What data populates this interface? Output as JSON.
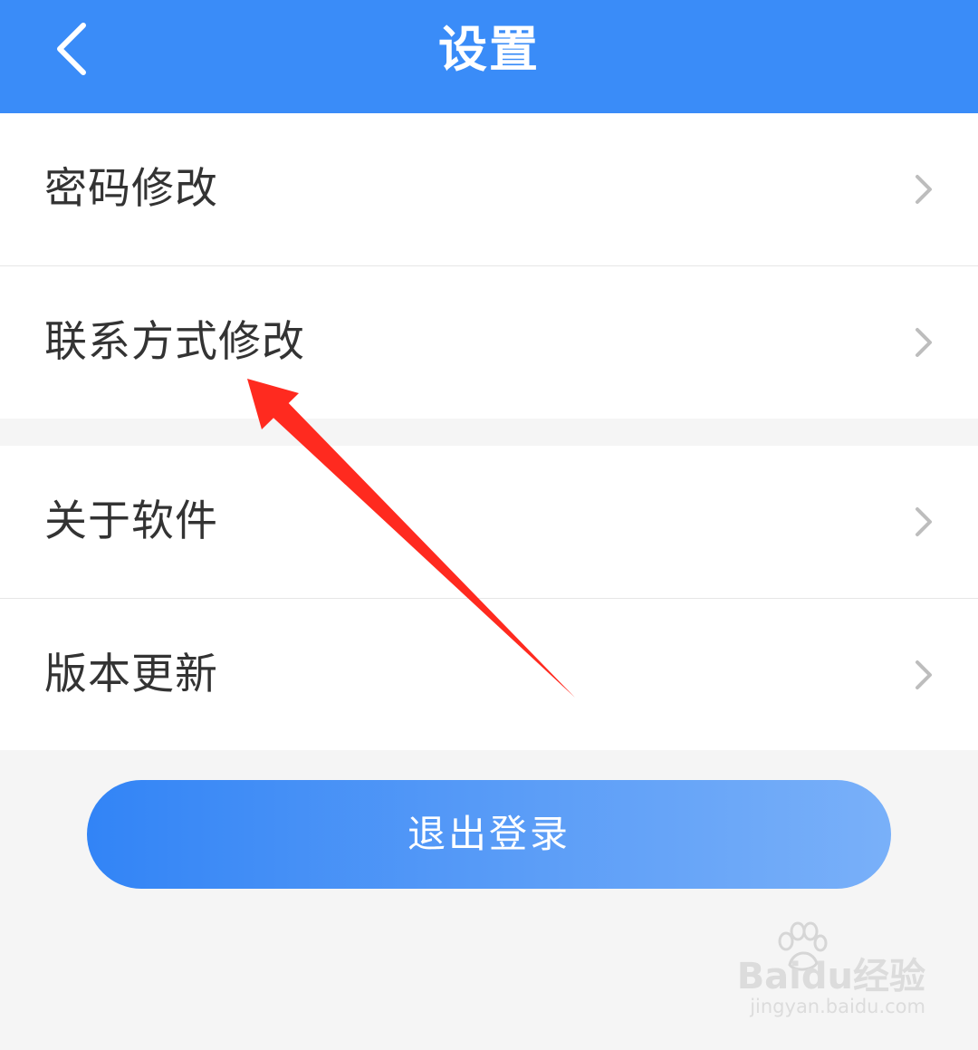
{
  "header": {
    "title": "设置",
    "background": "#3a8cf8",
    "back_icon": "chevron-left-icon"
  },
  "settings_group_1": [
    {
      "label": "密码修改",
      "icon": "chevron-right-icon"
    },
    {
      "label": "联系方式修改",
      "icon": "chevron-right-icon"
    }
  ],
  "settings_group_2": [
    {
      "label": "关于软件",
      "icon": "chevron-right-icon"
    },
    {
      "label": "版本更新",
      "icon": "chevron-right-icon"
    }
  ],
  "logout_button": {
    "label": "退出登录",
    "color": "#3284f6"
  },
  "annotation": {
    "color": "#ff2a1f",
    "points_to": "联系方式修改"
  },
  "watermark": {
    "logo": "Baidu经验",
    "url": "jingyan.baidu.com"
  }
}
